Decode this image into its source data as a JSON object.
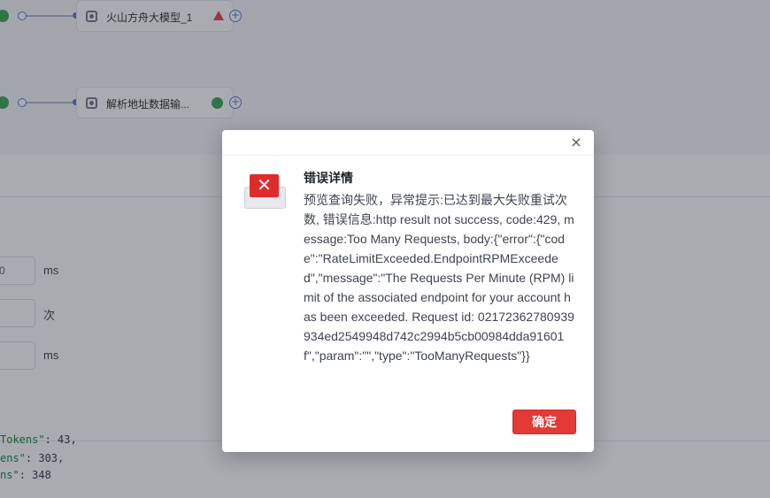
{
  "canvas": {
    "nodes": [
      {
        "title": "火山方舟大模型_1",
        "status": "warning"
      },
      {
        "title": "解析地址数据输...",
        "status": "ok"
      }
    ],
    "add_symbol": "+"
  },
  "panel": {
    "fields": [
      {
        "value": "0",
        "unit": "ms"
      },
      {
        "value": "",
        "unit": "次"
      },
      {
        "value": "",
        "unit": "ms"
      }
    ]
  },
  "code": {
    "lines": [
      {
        "key": "Tokens\"",
        "rest": ": 43,"
      },
      {
        "key": "ens\"",
        "rest": ": 303,"
      },
      {
        "key": "ns\"",
        "rest": ": 348"
      }
    ]
  },
  "dialog": {
    "close_symbol": "×",
    "icon_symbol": "✕",
    "title": "错误详情",
    "message": "预览查询失败，异常提示:已达到最大失败重试次数, 错误信息:http result not success, code:429, message:Too Many Requests, body:{\"error\":{\"code\":\"RateLimitExceeded.EndpointRPMExceeded\",\"message\":\"The Requests Per Minute (RPM) limit of the associated endpoint for your account has been exceeded. Request id: 02172362780939934ed2549948d742c2994b5cb00984dda91601f\",\"param\":\"\",\"type\":\"TooManyRequests\"}}",
    "confirm_label": "确定"
  },
  "colors": {
    "accent_red": "#e33a36",
    "ok_green": "#2fa14b",
    "port_blue": "#4e6fd8"
  }
}
